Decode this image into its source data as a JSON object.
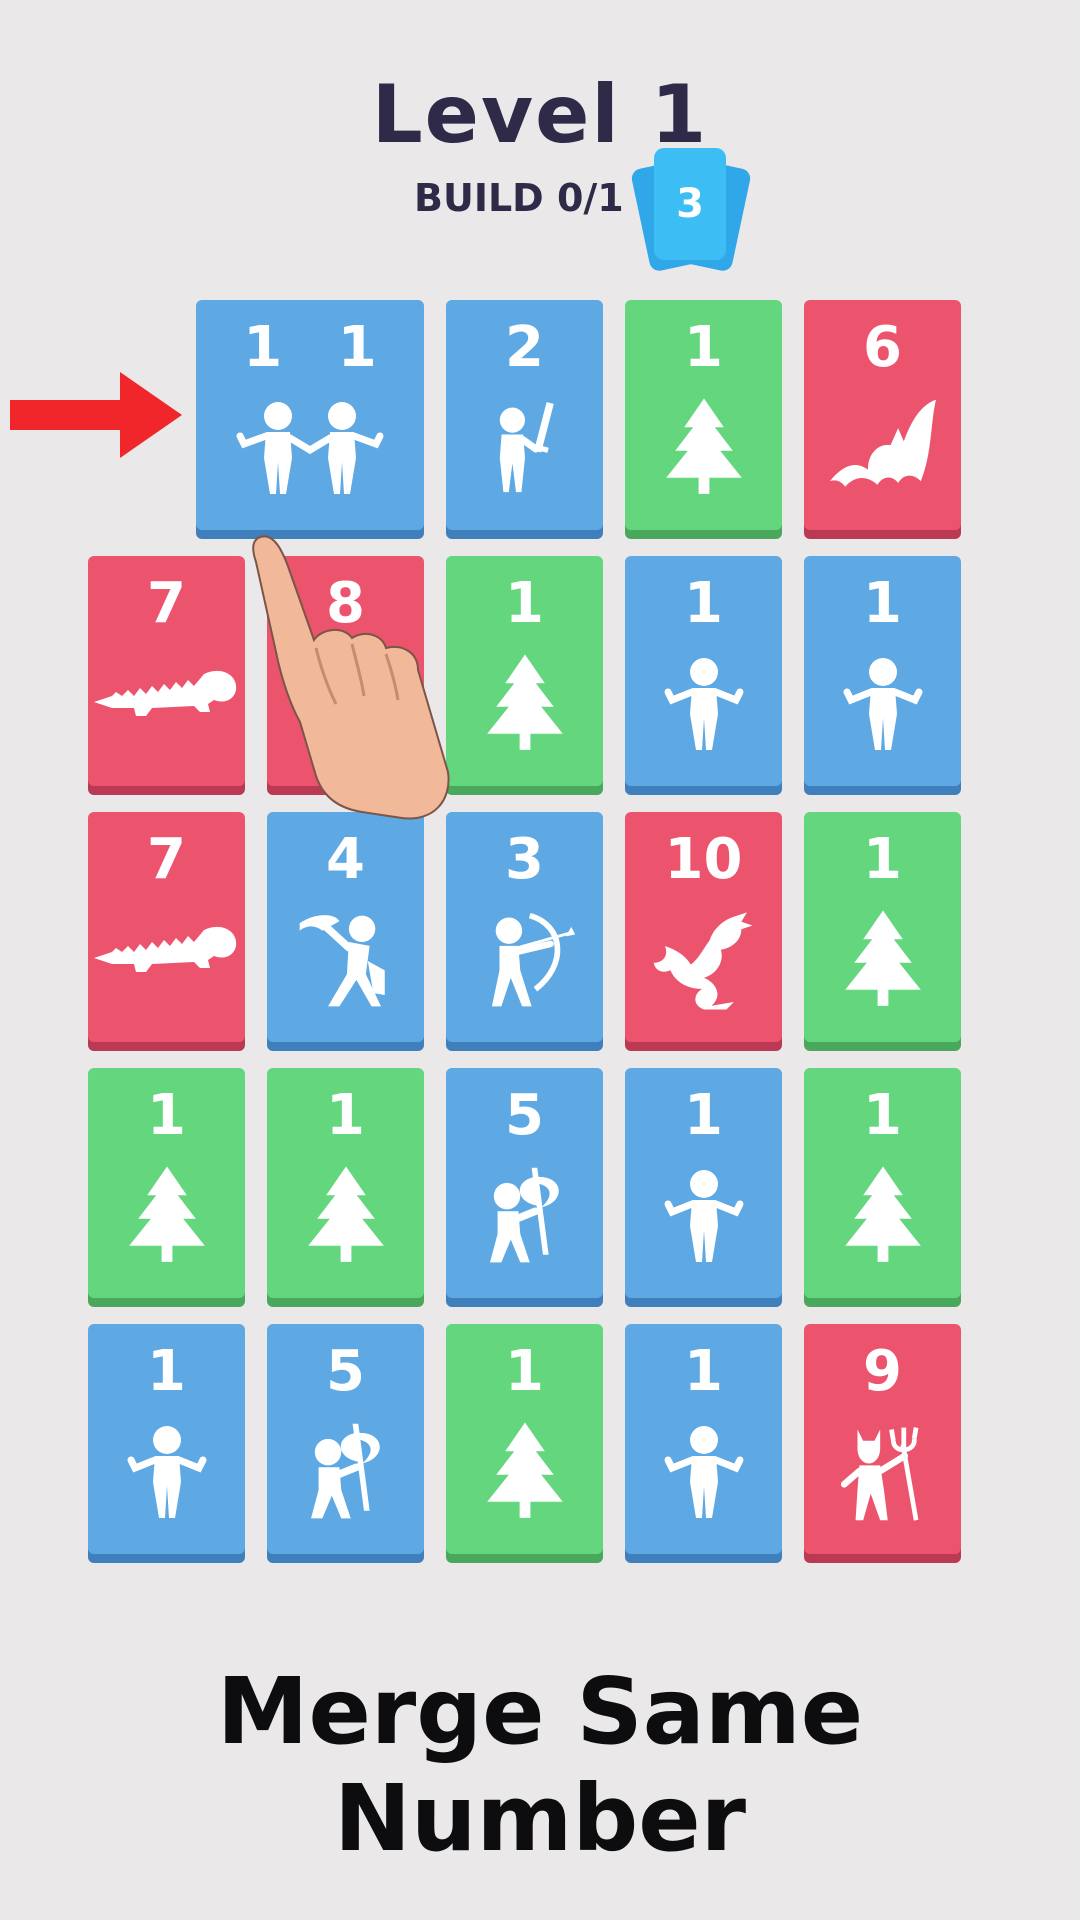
{
  "header": {
    "title": "Level 1",
    "build_label": "BUILD 0/1",
    "deck_count": "3"
  },
  "colors": {
    "blue": "#5ea8e4",
    "green": "#63d67e",
    "red": "#ec546e",
    "deck": "#3cbef5"
  },
  "grid": {
    "rows": [
      [
        {
          "value": "1 1",
          "color": "blue",
          "icon": "two-people-icon"
        },
        {
          "value": "2",
          "color": "blue",
          "icon": "swordsman-icon"
        },
        {
          "value": "1",
          "color": "green",
          "icon": "tree-icon"
        },
        {
          "value": "6",
          "color": "red",
          "icon": "bat-icon"
        }
      ],
      [
        {
          "value": "7",
          "color": "red",
          "icon": "crocodile-icon"
        },
        {
          "value": "8",
          "color": "red",
          "icon": "skeleton-icon"
        },
        {
          "value": "1",
          "color": "green",
          "icon": "tree-icon"
        },
        {
          "value": "1",
          "color": "blue",
          "icon": "person-icon"
        },
        {
          "value": "1",
          "color": "blue",
          "icon": "person-icon"
        }
      ],
      [
        {
          "value": "7",
          "color": "red",
          "icon": "crocodile-icon"
        },
        {
          "value": "4",
          "color": "blue",
          "icon": "warrior-icon"
        },
        {
          "value": "3",
          "color": "blue",
          "icon": "archer-icon"
        },
        {
          "value": "10",
          "color": "red",
          "icon": "dragon-icon"
        },
        {
          "value": "1",
          "color": "green",
          "icon": "tree-icon"
        }
      ],
      [
        {
          "value": "1",
          "color": "green",
          "icon": "tree-icon"
        },
        {
          "value": "1",
          "color": "green",
          "icon": "tree-icon"
        },
        {
          "value": "5",
          "color": "blue",
          "icon": "axeman-icon"
        },
        {
          "value": "1",
          "color": "blue",
          "icon": "person-icon"
        },
        {
          "value": "1",
          "color": "green",
          "icon": "tree-icon"
        }
      ],
      [
        {
          "value": "1",
          "color": "blue",
          "icon": "person-icon"
        },
        {
          "value": "5",
          "color": "blue",
          "icon": "axeman-icon"
        },
        {
          "value": "1",
          "color": "green",
          "icon": "tree-icon"
        },
        {
          "value": "1",
          "color": "blue",
          "icon": "person-icon"
        },
        {
          "value": "9",
          "color": "red",
          "icon": "devil-icon"
        }
      ]
    ]
  },
  "hints": {
    "arrow_icon": "red-arrow-icon",
    "hand_icon": "pointing-hand-icon"
  },
  "caption": "Merge Same Number"
}
